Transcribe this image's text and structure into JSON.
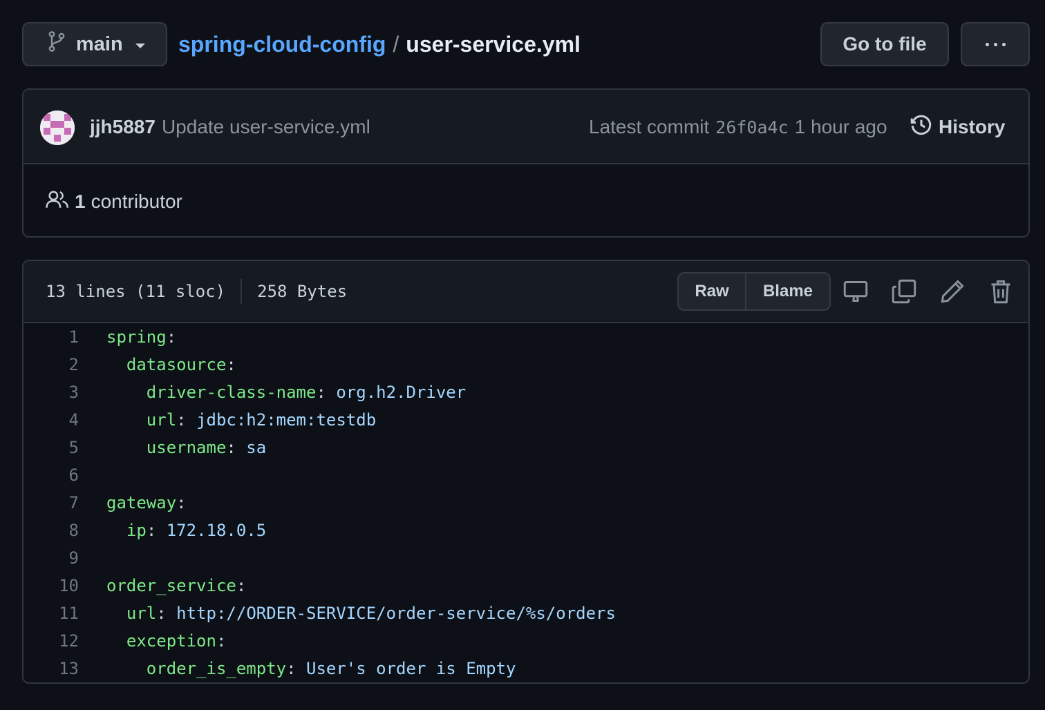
{
  "branch": {
    "name": "main"
  },
  "breadcrumb": {
    "repo": "spring-cloud-config",
    "separator": "/",
    "file": "user-service.yml"
  },
  "actions": {
    "go_to_file": "Go to file"
  },
  "commit": {
    "author": "jjh5887",
    "message": "Update user-service.yml",
    "latest_label": "Latest commit",
    "sha": "26f0a4c",
    "time": "1 hour ago",
    "history_label": "History"
  },
  "contributors": {
    "count": "1",
    "label": "contributor"
  },
  "file": {
    "lines_info": "13 lines (11 sloc)",
    "size": "258 Bytes",
    "raw_label": "Raw",
    "blame_label": "Blame"
  },
  "code_lines": [
    {
      "n": "1",
      "indent": "",
      "key": "spring",
      "colon": ":",
      "val": ""
    },
    {
      "n": "2",
      "indent": "  ",
      "key": "datasource",
      "colon": ":",
      "val": ""
    },
    {
      "n": "3",
      "indent": "    ",
      "key": "driver-class-name",
      "colon": ": ",
      "val": "org.h2.Driver"
    },
    {
      "n": "4",
      "indent": "    ",
      "key": "url",
      "colon": ": ",
      "val": "jdbc:h2:mem:testdb"
    },
    {
      "n": "5",
      "indent": "    ",
      "key": "username",
      "colon": ": ",
      "val": "sa"
    },
    {
      "n": "6",
      "indent": "",
      "key": "",
      "colon": "",
      "val": ""
    },
    {
      "n": "7",
      "indent": "",
      "key": "gateway",
      "colon": ":",
      "val": ""
    },
    {
      "n": "8",
      "indent": "  ",
      "key": "ip",
      "colon": ": ",
      "val": "172.18.0.5"
    },
    {
      "n": "9",
      "indent": "",
      "key": "",
      "colon": "",
      "val": ""
    },
    {
      "n": "10",
      "indent": "",
      "key": "order_service",
      "colon": ":",
      "val": ""
    },
    {
      "n": "11",
      "indent": "  ",
      "key": "url",
      "colon": ": ",
      "val": "http://ORDER-SERVICE/order-service/%s/orders"
    },
    {
      "n": "12",
      "indent": "  ",
      "key": "exception",
      "colon": ":",
      "val": ""
    },
    {
      "n": "13",
      "indent": "    ",
      "key": "order_is_empty",
      "colon": ": ",
      "val": "User's order is Empty"
    }
  ],
  "colors": {
    "background": "#0d1117",
    "link": "#58a6ff",
    "yaml_key": "#7ee787",
    "yaml_value": "#a5d6ff"
  },
  "icons": [
    "git-branch-icon",
    "history-icon",
    "people-icon",
    "desktop-icon",
    "copy-icon",
    "pencil-icon",
    "trash-icon",
    "kebab-icon"
  ]
}
